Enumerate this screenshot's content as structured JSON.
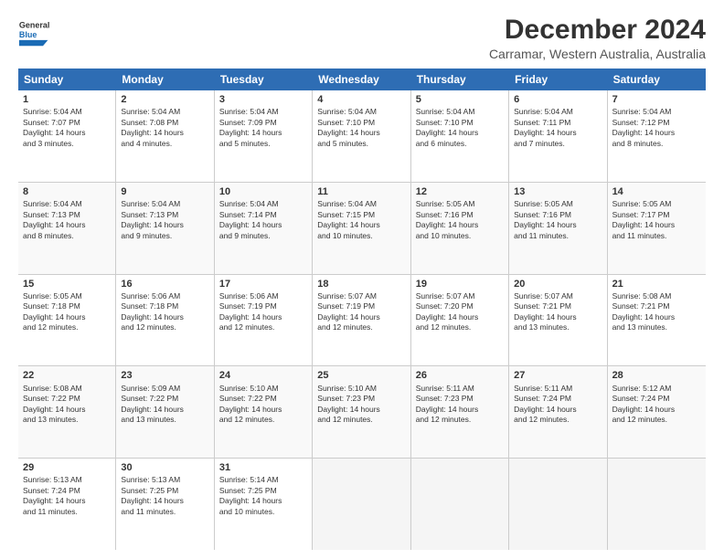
{
  "logo": {
    "line1": "General",
    "line2": "Blue"
  },
  "title": "December 2024",
  "subtitle": "Carramar, Western Australia, Australia",
  "headers": [
    "Sunday",
    "Monday",
    "Tuesday",
    "Wednesday",
    "Thursday",
    "Friday",
    "Saturday"
  ],
  "rows": [
    [
      {
        "day": "1",
        "info": "Sunrise: 5:04 AM\nSunset: 7:07 PM\nDaylight: 14 hours\nand 3 minutes."
      },
      {
        "day": "2",
        "info": "Sunrise: 5:04 AM\nSunset: 7:08 PM\nDaylight: 14 hours\nand 4 minutes."
      },
      {
        "day": "3",
        "info": "Sunrise: 5:04 AM\nSunset: 7:09 PM\nDaylight: 14 hours\nand 5 minutes."
      },
      {
        "day": "4",
        "info": "Sunrise: 5:04 AM\nSunset: 7:10 PM\nDaylight: 14 hours\nand 5 minutes."
      },
      {
        "day": "5",
        "info": "Sunrise: 5:04 AM\nSunset: 7:10 PM\nDaylight: 14 hours\nand 6 minutes."
      },
      {
        "day": "6",
        "info": "Sunrise: 5:04 AM\nSunset: 7:11 PM\nDaylight: 14 hours\nand 7 minutes."
      },
      {
        "day": "7",
        "info": "Sunrise: 5:04 AM\nSunset: 7:12 PM\nDaylight: 14 hours\nand 8 minutes."
      }
    ],
    [
      {
        "day": "8",
        "info": "Sunrise: 5:04 AM\nSunset: 7:13 PM\nDaylight: 14 hours\nand 8 minutes."
      },
      {
        "day": "9",
        "info": "Sunrise: 5:04 AM\nSunset: 7:13 PM\nDaylight: 14 hours\nand 9 minutes."
      },
      {
        "day": "10",
        "info": "Sunrise: 5:04 AM\nSunset: 7:14 PM\nDaylight: 14 hours\nand 9 minutes."
      },
      {
        "day": "11",
        "info": "Sunrise: 5:04 AM\nSunset: 7:15 PM\nDaylight: 14 hours\nand 10 minutes."
      },
      {
        "day": "12",
        "info": "Sunrise: 5:05 AM\nSunset: 7:16 PM\nDaylight: 14 hours\nand 10 minutes."
      },
      {
        "day": "13",
        "info": "Sunrise: 5:05 AM\nSunset: 7:16 PM\nDaylight: 14 hours\nand 11 minutes."
      },
      {
        "day": "14",
        "info": "Sunrise: 5:05 AM\nSunset: 7:17 PM\nDaylight: 14 hours\nand 11 minutes."
      }
    ],
    [
      {
        "day": "15",
        "info": "Sunrise: 5:05 AM\nSunset: 7:18 PM\nDaylight: 14 hours\nand 12 minutes."
      },
      {
        "day": "16",
        "info": "Sunrise: 5:06 AM\nSunset: 7:18 PM\nDaylight: 14 hours\nand 12 minutes."
      },
      {
        "day": "17",
        "info": "Sunrise: 5:06 AM\nSunset: 7:19 PM\nDaylight: 14 hours\nand 12 minutes."
      },
      {
        "day": "18",
        "info": "Sunrise: 5:07 AM\nSunset: 7:19 PM\nDaylight: 14 hours\nand 12 minutes."
      },
      {
        "day": "19",
        "info": "Sunrise: 5:07 AM\nSunset: 7:20 PM\nDaylight: 14 hours\nand 12 minutes."
      },
      {
        "day": "20",
        "info": "Sunrise: 5:07 AM\nSunset: 7:21 PM\nDaylight: 14 hours\nand 13 minutes."
      },
      {
        "day": "21",
        "info": "Sunrise: 5:08 AM\nSunset: 7:21 PM\nDaylight: 14 hours\nand 13 minutes."
      }
    ],
    [
      {
        "day": "22",
        "info": "Sunrise: 5:08 AM\nSunset: 7:22 PM\nDaylight: 14 hours\nand 13 minutes."
      },
      {
        "day": "23",
        "info": "Sunrise: 5:09 AM\nSunset: 7:22 PM\nDaylight: 14 hours\nand 13 minutes."
      },
      {
        "day": "24",
        "info": "Sunrise: 5:10 AM\nSunset: 7:22 PM\nDaylight: 14 hours\nand 12 minutes."
      },
      {
        "day": "25",
        "info": "Sunrise: 5:10 AM\nSunset: 7:23 PM\nDaylight: 14 hours\nand 12 minutes."
      },
      {
        "day": "26",
        "info": "Sunrise: 5:11 AM\nSunset: 7:23 PM\nDaylight: 14 hours\nand 12 minutes."
      },
      {
        "day": "27",
        "info": "Sunrise: 5:11 AM\nSunset: 7:24 PM\nDaylight: 14 hours\nand 12 minutes."
      },
      {
        "day": "28",
        "info": "Sunrise: 5:12 AM\nSunset: 7:24 PM\nDaylight: 14 hours\nand 12 minutes."
      }
    ],
    [
      {
        "day": "29",
        "info": "Sunrise: 5:13 AM\nSunset: 7:24 PM\nDaylight: 14 hours\nand 11 minutes."
      },
      {
        "day": "30",
        "info": "Sunrise: 5:13 AM\nSunset: 7:25 PM\nDaylight: 14 hours\nand 11 minutes."
      },
      {
        "day": "31",
        "info": "Sunrise: 5:14 AM\nSunset: 7:25 PM\nDaylight: 14 hours\nand 10 minutes."
      },
      {
        "day": "",
        "info": ""
      },
      {
        "day": "",
        "info": ""
      },
      {
        "day": "",
        "info": ""
      },
      {
        "day": "",
        "info": ""
      }
    ]
  ]
}
